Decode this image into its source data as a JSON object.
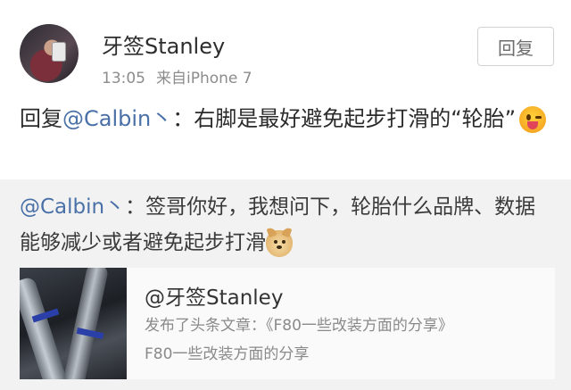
{
  "post": {
    "author": "牙签Stanley",
    "time": "13:05",
    "source": "来自iPhone 7",
    "reply_button_label": "回复",
    "reply_prefix": "回复",
    "reply_mention": "@Calbin丶",
    "reply_colon": "：",
    "reply_body": "右脚是最好避免起步打滑的“轮胎”",
    "reply_emoji": "tongue-out-emoji"
  },
  "original": {
    "mention": "@Calbin丶",
    "colon": "：",
    "body": "签哥你好，我想问下，轮胎什么品牌、数据能够减少或者避免起步打滑",
    "emoji": "doge-emoji"
  },
  "card": {
    "title": "@牙签Stanley",
    "line1": "发布了头条文章：《F80一些改装方面的分享》",
    "line2": "F80一些改装方面的分享",
    "thumbnail": "exhaust-pipes-photo"
  },
  "colors": {
    "mention": "#4a70a8",
    "quote_background": "#f2f2f2",
    "meta_text": "#8c8c8c"
  }
}
